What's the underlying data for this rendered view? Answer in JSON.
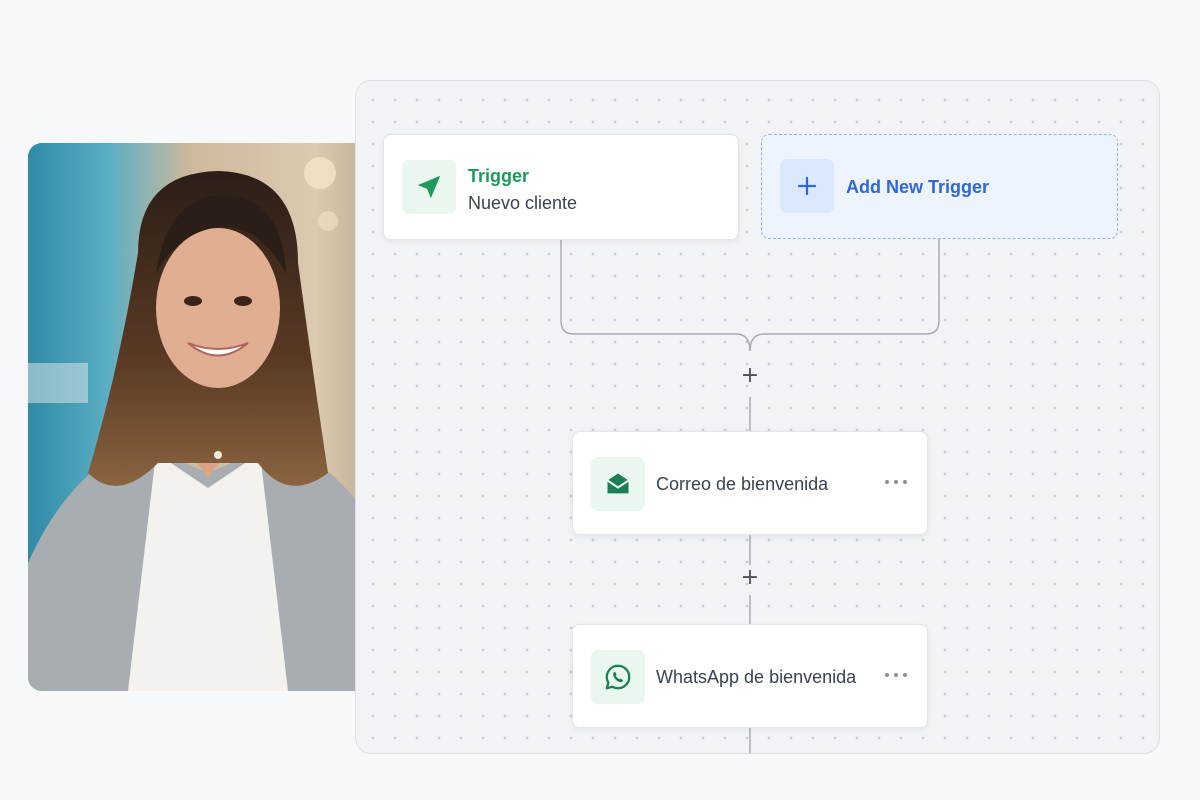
{
  "photo": {
    "description_icon": "person-photo"
  },
  "trigger": {
    "icon": "navigation-arrow-icon",
    "title": "Trigger",
    "subtitle": "Nuevo cliente"
  },
  "add_trigger": {
    "icon": "plus-icon",
    "label": "Add New Trigger"
  },
  "steps": [
    {
      "icon": "envelope-icon",
      "label": "Correo de bienvenida",
      "more": "more-options-icon"
    },
    {
      "icon": "whatsapp-icon",
      "label": "WhatsApp de bienvenida",
      "more": "more-options-icon"
    }
  ],
  "add_step_symbol": "+",
  "colors": {
    "accent_green": "#1e9a5a",
    "accent_blue": "#2f66d9",
    "icon_tile_green": "#e9f7ef",
    "add_tile_blue": "#dbe7fb"
  }
}
